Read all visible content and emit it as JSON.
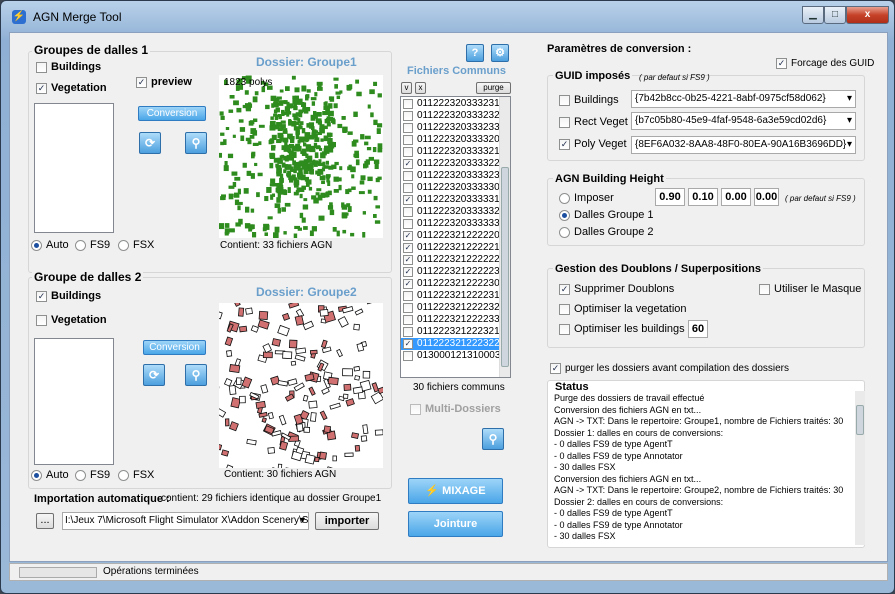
{
  "window": {
    "title": "AGN Merge Tool",
    "min": "▁",
    "max": "□",
    "close": "x"
  },
  "help_label": "?",
  "group1": {
    "title": "Groupes de dalles 1",
    "buildings": "Buildings",
    "vegetation": "Vegetation",
    "preview": "preview",
    "conversion": "Conversion",
    "folder": "Dossier:  Groupe1",
    "polys": "1823 polys",
    "contains": "Contient: 33 fichiers AGN",
    "radios": [
      "Auto",
      "FS9",
      "FSX"
    ]
  },
  "group2": {
    "title": "Groupe de dalles 2",
    "buildings": "Buildings",
    "vegetation": "Vegetation",
    "conversion": "Conversion",
    "folder": "Dossier:  Groupe2",
    "contains": "Contient: 30 fichiers AGN",
    "radios": [
      "Auto",
      "FS9",
      "FSX"
    ]
  },
  "common": {
    "title": "Fichiers Communs",
    "v": "v",
    "x": "x",
    "purge": "purge",
    "count": "30 fichiers communs",
    "multi": "Multi-Dossiers",
    "files": [
      {
        "name": "011222320333231",
        "checked": false
      },
      {
        "name": "011222320333232",
        "checked": false
      },
      {
        "name": "011222320333233",
        "checked": false
      },
      {
        "name": "011222320333320",
        "checked": false
      },
      {
        "name": "011222320333321",
        "checked": false
      },
      {
        "name": "011222320333322",
        "checked": true
      },
      {
        "name": "011222320333323",
        "checked": false
      },
      {
        "name": "011222320333330",
        "checked": false
      },
      {
        "name": "011222320333331",
        "checked": true
      },
      {
        "name": "011222320333332",
        "checked": false
      },
      {
        "name": "011222320333333",
        "checked": false
      },
      {
        "name": "011222321222220",
        "checked": true
      },
      {
        "name": "011222321222221",
        "checked": true
      },
      {
        "name": "011222321222222",
        "checked": true
      },
      {
        "name": "011222321222223",
        "checked": true
      },
      {
        "name": "011222321222230",
        "checked": true
      },
      {
        "name": "011222321222231",
        "checked": false
      },
      {
        "name": "011222321222232",
        "checked": false
      },
      {
        "name": "011222321222233",
        "checked": false
      },
      {
        "name": "011222321222321",
        "checked": false
      },
      {
        "name": "011222321222322",
        "checked": true,
        "selected": true
      },
      {
        "name": "013000121310003",
        "checked": false
      }
    ]
  },
  "mix": {
    "mixage": "MIXAGE",
    "jointure": "Jointure"
  },
  "import": {
    "label": "Importation automatique :",
    "info": "contient: 29 fichiers identique au dossier Groupe1",
    "browse": "...",
    "path": "I:\\Jeux 7\\Microsoft Flight Simulator X\\Addon Scenery\\Sc",
    "button": "importer"
  },
  "params": {
    "title": "Paramètres de conversion :",
    "force_guid": "Forcage des GUID",
    "guid": {
      "title": "GUID imposés",
      "note": "( par defaut si FS9 )",
      "rows": [
        {
          "label": "Buildings",
          "value": "{7b42b8cc-0b25-4221-8abf-0975cf58d062}",
          "checked": false
        },
        {
          "label": "Rect Veget",
          "value": "{b7c05b80-45e9-4faf-9548-6a3e59cd02d6}",
          "checked": false
        },
        {
          "label": "Poly Veget",
          "value": "{8EF6A032-8AA8-48F0-80EA-90A16B3696DD}",
          "checked": true
        }
      ]
    },
    "height": {
      "title": "AGN Building Height",
      "imposer": "Imposer",
      "g1": "Dalles Groupe 1",
      "g2": "Dalles Groupe 2",
      "vals": [
        "0.90",
        "0.10",
        "0.00",
        "0.00"
      ],
      "note": "( par defaut si FS9 )"
    },
    "doublons": {
      "title": "Gestion des Doublons / Superpositions",
      "supprimer": "Supprimer Doublons",
      "masque": "Utiliser le Masque",
      "opt_veg": "Optimiser la vegetation",
      "opt_bld": "Optimiser les buildings",
      "opt_val": "60"
    },
    "purge_label": "purger les dossiers avant compilation des dossiers"
  },
  "status": {
    "title": "Status",
    "lines": [
      "Purge des dossiers de travail effectué",
      "Conversion des fichiers AGN en txt...",
      "AGN -> TXT: Dans le repertoire: Groupe1, nombre de Fichiers traités: 30",
      "Dossier 1: dalles en cours de conversions:",
      "- 0 dalles FS9 de type AgentT",
      "- 0 dalles FS9 de type Annotator",
      "- 30 dalles FSX",
      "Conversion des fichiers AGN en txt...",
      "AGN -> TXT: Dans le repertoire: Groupe2, nombre de Fichiers traités: 30",
      "Dossier 2: dalles en cours de conversions:",
      "- 0 dalles FS9 de type AgentT",
      "- 0 dalles FS9 de type Annotator",
      "- 30 dalles FSX"
    ]
  },
  "statusbar": {
    "text": "Opérations terminées"
  },
  "colors": {
    "veg": "#2e8b1e",
    "bld": "#8b1a1a",
    "accent": "#4aa6e8"
  }
}
